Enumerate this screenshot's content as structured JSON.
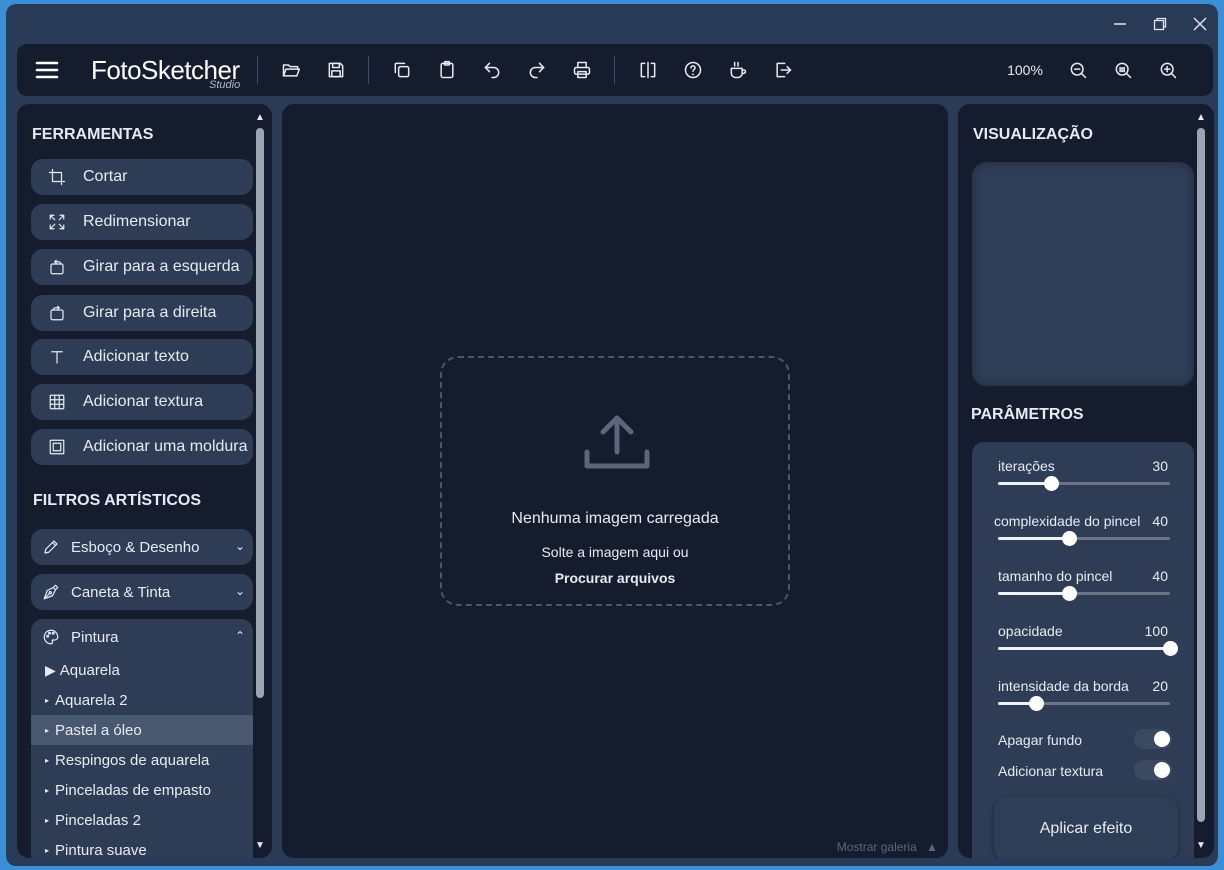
{
  "window": {
    "minimize_icon": "minimize-icon",
    "restore_icon": "restore-icon",
    "close_icon": "close-icon"
  },
  "app": {
    "name": "FotoSketcher",
    "edition": "Studio"
  },
  "toolbar": {
    "zoom": "100%"
  },
  "tools": {
    "title": "FERRAMENTAS",
    "items": [
      {
        "label": "Cortar",
        "icon": "crop-icon"
      },
      {
        "label": "Redimensionar",
        "icon": "resize-icon"
      },
      {
        "label": "Girar para a esquerda",
        "icon": "rotate-left-icon"
      },
      {
        "label": "Girar para a direita",
        "icon": "rotate-right-icon"
      },
      {
        "label": "Adicionar texto",
        "icon": "text-icon"
      },
      {
        "label": "Adicionar textura",
        "icon": "grid-icon"
      },
      {
        "label": "Adicionar uma moldura",
        "icon": "frame-icon"
      }
    ]
  },
  "filters": {
    "title": "FILTROS ARTÍSTICOS",
    "groups": [
      {
        "label": "Esboço & Desenho",
        "icon": "pencil-icon"
      },
      {
        "label": "Caneta & Tinta",
        "icon": "pen-nib-icon"
      },
      {
        "label": "Pintura",
        "icon": "palette-icon"
      }
    ],
    "painting_items": [
      "Aquarela",
      "Aquarela 2",
      "Pastel a óleo",
      "Respingos de aquarela",
      "Pinceladas de empasto",
      "Pinceladas 2",
      "Pintura suave"
    ],
    "selected": "Pastel a óleo"
  },
  "canvas": {
    "empty_title": "Nenhuma imagem carregada",
    "drop_text": "Solte a imagem aqui ou",
    "browse_link": "Procurar arquivos",
    "gallery_toggle": "Mostrar galeria"
  },
  "preview": {
    "title": "VISUALIZAÇÃO"
  },
  "parameters": {
    "title": "PARÂMETROS",
    "sliders": [
      {
        "label": "iterações",
        "value": "30",
        "fraction": 0.31
      },
      {
        "label": "complexidade do pincel",
        "value": "40",
        "fraction": 0.41
      },
      {
        "label": "tamanho do pincel",
        "value": "40",
        "fraction": 0.41
      },
      {
        "label": "opacidade",
        "value": "100",
        "fraction": 1.0
      },
      {
        "label": "intensidade da borda",
        "value": "20",
        "fraction": 0.22
      }
    ],
    "toggles": [
      {
        "label": "Apagar fundo",
        "on": true
      },
      {
        "label": "Adicionar textura",
        "on": true
      }
    ],
    "apply_label": "Aplicar efeito"
  }
}
